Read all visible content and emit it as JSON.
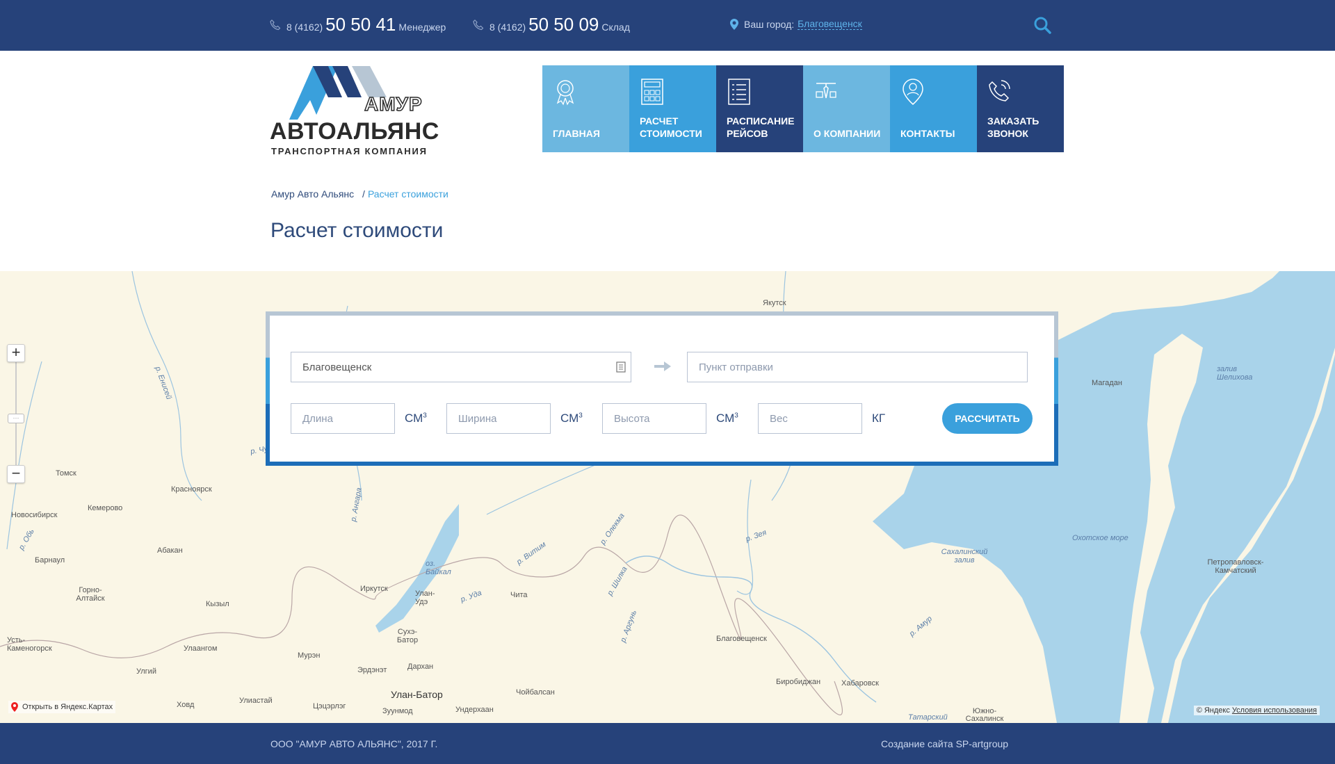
{
  "topbar": {
    "phones": [
      {
        "prefix": "8 (4162)",
        "number": "50 50 41",
        "label": "Менеджер"
      },
      {
        "prefix": "8 (4162)",
        "number": "50 50 09",
        "label": "Склад"
      }
    ],
    "city_label": "Ваш город:",
    "city_value": "Благовещенск",
    "icons": {
      "phone": "phone-icon",
      "pin": "location-pin-icon",
      "search": "search-icon"
    }
  },
  "logo": {
    "line1": "АМУР",
    "line2": "АВТОАЛЬЯНС",
    "line3": "ТРАНСПОРТНАЯ КОМПАНИЯ"
  },
  "nav": [
    {
      "label": "Главная",
      "icon": "award-icon",
      "color": "#6cb7e0"
    },
    {
      "label": "Расчет стоимости",
      "icon": "calculator-icon",
      "color": "#3aa0dc"
    },
    {
      "label": "Расписание рейсов",
      "icon": "list-icon",
      "color": "#26427a"
    },
    {
      "label": "О компании",
      "icon": "businessman-icon",
      "color": "#6cb7e0"
    },
    {
      "label": "Контакты",
      "icon": "person-pin-icon",
      "color": "#3aa0dc"
    },
    {
      "label": "Заказать звонок",
      "icon": "phone-call-icon",
      "color": "#26427a"
    }
  ],
  "breadcrumb": {
    "home": "Амур Авто Альянс",
    "separator": "/",
    "current": "Расчет стоимости"
  },
  "page_title": "Расчет стоимости",
  "calculator": {
    "from_value": "Благовещенск",
    "to_placeholder": "Пункт отправки",
    "length_placeholder": "Длина",
    "width_placeholder": "Ширина",
    "height_placeholder": "Высота",
    "weight_placeholder": "Вес",
    "unit_cm": "СМ",
    "unit_cm_sup": "3",
    "unit_kg": "КГ",
    "submit_label": "Рассчитать"
  },
  "map": {
    "labels": [
      "Якутск",
      "Магадан",
      "залив Шелихова",
      "Томск",
      "Красноярск",
      "Кемерово",
      "Новосибирск",
      "Барнаул",
      "Абакан",
      "Горно-Алтайск",
      "Кызыл",
      "Усть-Каменогорск",
      "Улаангом",
      "Улгий",
      "Ховд",
      "Улиастай",
      "Мурэн",
      "Цэцэрлэг",
      "Иркутск",
      "оз. Байкал",
      "Улан-Удэ",
      "Сухэ-Батор",
      "Дархан",
      "Эрдэнэт",
      "Улан-Батор",
      "Зуунмод",
      "Ундерхаан",
      "Чойбалсан",
      "Чита",
      "р. Удa",
      "р. Витим",
      "р. Олекма",
      "р. Шилка",
      "р. Аргунь",
      "р. Зея",
      "Благовещенск",
      "Биробиджан",
      "Хабаровск",
      "р. Амур",
      "Сахалинский залив",
      "Охотское море",
      "Петропавловск-Камчатский",
      "Татарский",
      "Южно-Сахалинск",
      "р. Енисей",
      "р. Обь",
      "р. Ангара",
      "р. Чулым"
    ],
    "open_link": "Открыть в Яндекс.Картах",
    "copyright": "© Яндекс",
    "terms": "Условия использования",
    "zoom_in": "+",
    "zoom_out": "−"
  },
  "footer": {
    "copyright": "ООО \"АМУР АВТО АЛЬЯНС\", 2017 Г.",
    "developer": "Создание сайта SP-artgroup"
  }
}
